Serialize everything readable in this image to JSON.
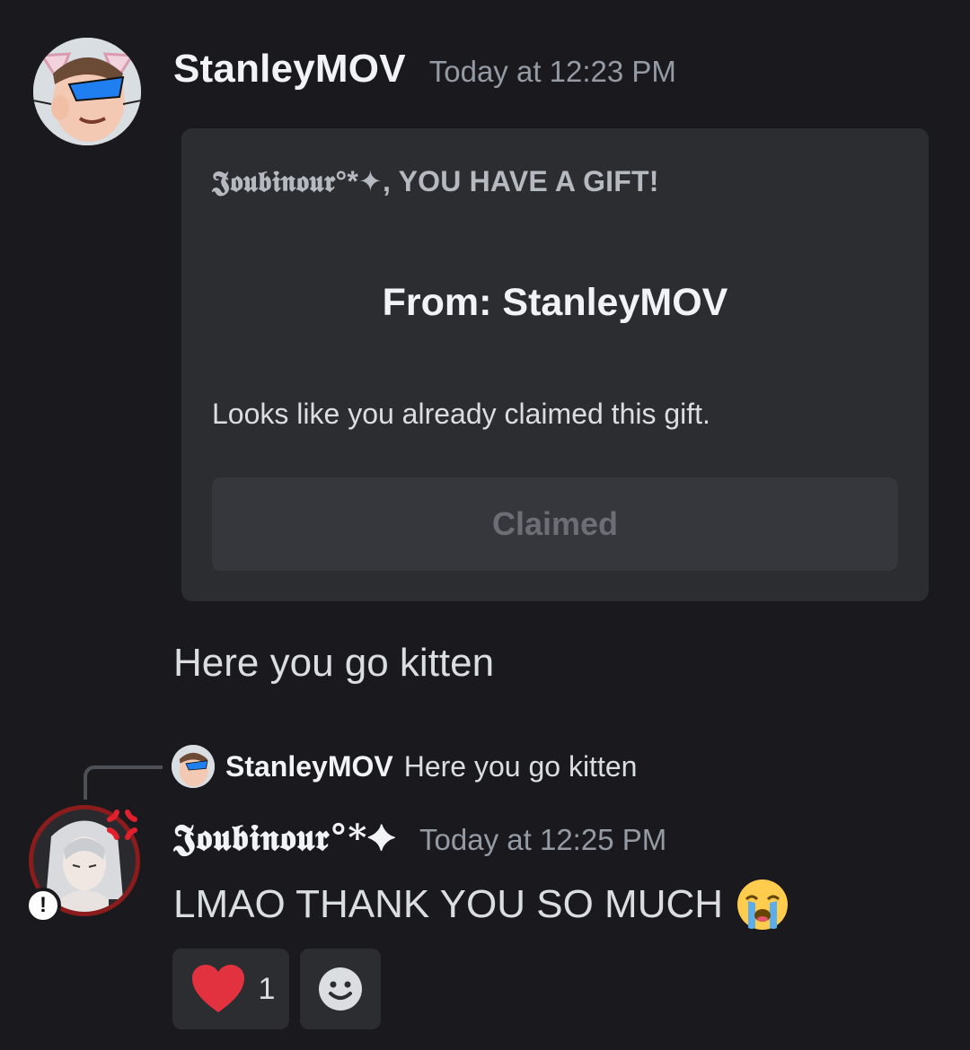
{
  "message1": {
    "author": "StanleyMOV",
    "timestamp": "Today at 12:23 PM",
    "gift": {
      "title": "𝕵𝖔𝖚𝖇𝖎𝖓𝖔𝖚𝖗°*✦, YOU HAVE A GIFT!",
      "from": "From: StanleyMOV",
      "description": "Looks like you already claimed this gift.",
      "button_label": "Claimed"
    },
    "text": "Here you go kitten"
  },
  "reply": {
    "author": "StanleyMOV",
    "text": "Here you go kitten"
  },
  "message2": {
    "author": "𝕵𝖔𝖚𝖇𝖎𝖓𝖔𝖚𝖗°*✦",
    "timestamp": "Today at 12:25 PM",
    "text": "LMAO THANK YOU SO MUCH",
    "badge": "!"
  },
  "reactions": [
    {
      "icon": "heart-icon",
      "count": "1"
    }
  ],
  "colors": {
    "background": "#1a1a1e",
    "card": "#2b2d31",
    "heart": "#e2323f"
  }
}
